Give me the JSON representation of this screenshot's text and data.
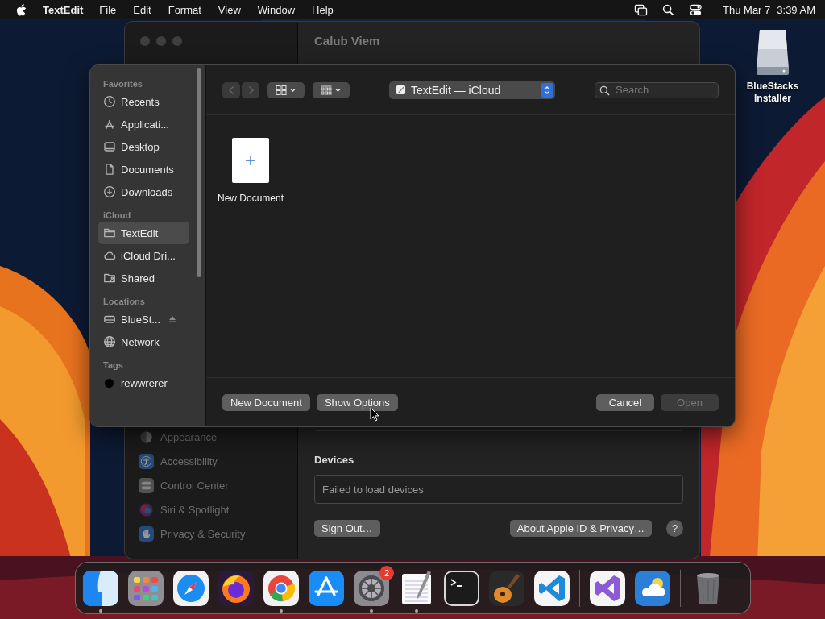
{
  "menu_bar": {
    "app_name": "TextEdit",
    "menus": [
      "File",
      "Edit",
      "Format",
      "View",
      "Window",
      "Help"
    ],
    "date": "Thu Mar 7",
    "time": "3:39 AM"
  },
  "desktop_items": [
    {
      "label": "BlueStacks Installer"
    }
  ],
  "settings_window": {
    "title": "Calub Viem",
    "sidebar_items": [
      {
        "label": "Appearance",
        "kind": "appearance"
      },
      {
        "label": "Accessibility",
        "kind": "accessibility"
      },
      {
        "label": "Control Center",
        "kind": "control"
      },
      {
        "label": "Siri & Spotlight",
        "kind": "siri"
      },
      {
        "label": "Privacy & Security",
        "kind": "privacy"
      }
    ],
    "section_title": "Devices",
    "devices_message": "Failed to load devices",
    "left_buttons": [
      "Sign Out…"
    ],
    "right_buttons": [
      "About Apple ID & Privacy…"
    ],
    "help_button": "?"
  },
  "open_dialog": {
    "nav_buttons": [
      {
        "kind": "back",
        "disabled": true
      },
      {
        "kind": "forward",
        "disabled": true
      }
    ],
    "location": "TextEdit — iCloud",
    "search": {
      "placeholder": "Search"
    },
    "sidebar": [
      {
        "heading": "Favorites",
        "items": [
          {
            "label": "Recents",
            "kind": "recents",
            "selected": false
          },
          {
            "label": "Applicati...",
            "kind": "apps",
            "selected": false
          },
          {
            "label": "Desktop",
            "kind": "desktop",
            "selected": false
          },
          {
            "label": "Documents",
            "kind": "document",
            "selected": false
          },
          {
            "label": "Downloads",
            "kind": "downloads",
            "selected": false
          }
        ]
      },
      {
        "heading": "iCloud",
        "items": [
          {
            "label": "TextEdit",
            "kind": "folder",
            "selected": true
          },
          {
            "label": "iCloud Dri...",
            "kind": "cloud",
            "selected": false
          },
          {
            "label": "Shared",
            "kind": "shared",
            "selected": false
          }
        ]
      },
      {
        "heading": "Locations",
        "items": [
          {
            "label": "BlueSt...",
            "kind": "drive",
            "selected": false,
            "ejectable": true
          },
          {
            "label": "Network",
            "kind": "globe",
            "selected": false
          }
        ]
      },
      {
        "heading": "Tags",
        "items": [
          {
            "label": "rewwrerer",
            "kind": "tag",
            "selected": false,
            "color": "#000000"
          }
        ]
      }
    ],
    "files": [
      {
        "name": "New Document"
      }
    ],
    "left_buttons": [
      {
        "label": "New Document",
        "disabled": false
      },
      {
        "label": "Show Options",
        "disabled": false
      }
    ],
    "right_buttons": [
      {
        "label": "Cancel",
        "disabled": false
      },
      {
        "label": "Open",
        "disabled": true
      }
    ]
  },
  "dock": {
    "sections": [
      {
        "apps": [
          {
            "kind": "finder",
            "running": true
          },
          {
            "kind": "launchpad",
            "running": false
          },
          {
            "kind": "safari",
            "running": false
          },
          {
            "kind": "firefox",
            "running": false
          },
          {
            "kind": "chrome",
            "running": true
          },
          {
            "kind": "appstore",
            "running": false
          },
          {
            "kind": "settings",
            "running": true,
            "badge": "2"
          },
          {
            "kind": "textedit",
            "running": true
          },
          {
            "kind": "terminal",
            "running": false
          },
          {
            "kind": "garageband",
            "running": false
          },
          {
            "kind": "vscode",
            "running": false
          }
        ]
      },
      {
        "apps": [
          {
            "kind": "visualstudio",
            "running": false
          },
          {
            "kind": "weather",
            "running": false
          }
        ]
      },
      {
        "apps": [
          {
            "kind": "trash",
            "running": false
          }
        ]
      }
    ]
  }
}
